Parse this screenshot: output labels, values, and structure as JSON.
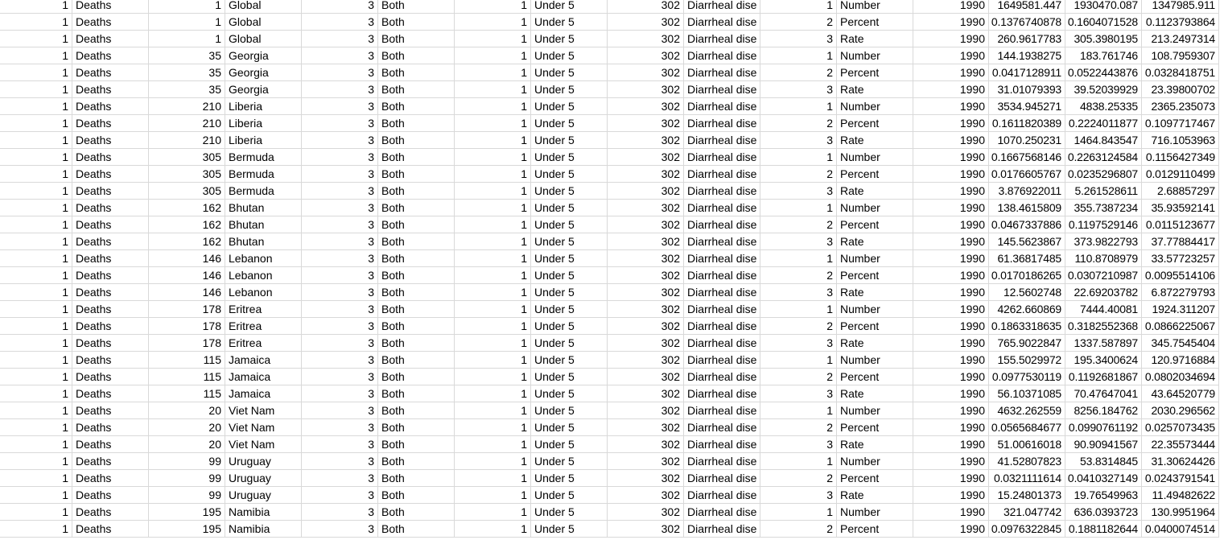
{
  "sheet": {
    "rows": [
      [
        "1",
        "Deaths",
        "1",
        "Global",
        "3",
        "Both",
        "1",
        "Under 5",
        "302",
        "Diarrheal dise",
        "1",
        "Number",
        "1990",
        "1649581.447",
        "1930470.087",
        "1347985.911"
      ],
      [
        "1",
        "Deaths",
        "1",
        "Global",
        "3",
        "Both",
        "1",
        "Under 5",
        "302",
        "Diarrheal dise",
        "2",
        "Percent",
        "1990",
        "0.1376740878",
        "0.1604071528",
        "0.1123793864"
      ],
      [
        "1",
        "Deaths",
        "1",
        "Global",
        "3",
        "Both",
        "1",
        "Under 5",
        "302",
        "Diarrheal dise",
        "3",
        "Rate",
        "1990",
        "260.9617783",
        "305.3980195",
        "213.2497314"
      ],
      [
        "1",
        "Deaths",
        "35",
        "Georgia",
        "3",
        "Both",
        "1",
        "Under 5",
        "302",
        "Diarrheal dise",
        "1",
        "Number",
        "1990",
        "144.1938275",
        "183.761746",
        "108.7959307"
      ],
      [
        "1",
        "Deaths",
        "35",
        "Georgia",
        "3",
        "Both",
        "1",
        "Under 5",
        "302",
        "Diarrheal dise",
        "2",
        "Percent",
        "1990",
        "0.0417128911",
        "0.0522443876",
        "0.0328418751"
      ],
      [
        "1",
        "Deaths",
        "35",
        "Georgia",
        "3",
        "Both",
        "1",
        "Under 5",
        "302",
        "Diarrheal dise",
        "3",
        "Rate",
        "1990",
        "31.01079393",
        "39.52039929",
        "23.39800702"
      ],
      [
        "1",
        "Deaths",
        "210",
        "Liberia",
        "3",
        "Both",
        "1",
        "Under 5",
        "302",
        "Diarrheal dise",
        "1",
        "Number",
        "1990",
        "3534.945271",
        "4838.25335",
        "2365.235073"
      ],
      [
        "1",
        "Deaths",
        "210",
        "Liberia",
        "3",
        "Both",
        "1",
        "Under 5",
        "302",
        "Diarrheal dise",
        "2",
        "Percent",
        "1990",
        "0.1611820389",
        "0.2224011877",
        "0.1097717467"
      ],
      [
        "1",
        "Deaths",
        "210",
        "Liberia",
        "3",
        "Both",
        "1",
        "Under 5",
        "302",
        "Diarrheal dise",
        "3",
        "Rate",
        "1990",
        "1070.250231",
        "1464.843547",
        "716.1053963"
      ],
      [
        "1",
        "Deaths",
        "305",
        "Bermuda",
        "3",
        "Both",
        "1",
        "Under 5",
        "302",
        "Diarrheal dise",
        "1",
        "Number",
        "1990",
        "0.1667568146",
        "0.2263124584",
        "0.1156427349"
      ],
      [
        "1",
        "Deaths",
        "305",
        "Bermuda",
        "3",
        "Both",
        "1",
        "Under 5",
        "302",
        "Diarrheal dise",
        "2",
        "Percent",
        "1990",
        "0.0176605767",
        "0.0235296807",
        "0.0129110499"
      ],
      [
        "1",
        "Deaths",
        "305",
        "Bermuda",
        "3",
        "Both",
        "1",
        "Under 5",
        "302",
        "Diarrheal dise",
        "3",
        "Rate",
        "1990",
        "3.876922011",
        "5.261528611",
        "2.68857297"
      ],
      [
        "1",
        "Deaths",
        "162",
        "Bhutan",
        "3",
        "Both",
        "1",
        "Under 5",
        "302",
        "Diarrheal dise",
        "1",
        "Number",
        "1990",
        "138.4615809",
        "355.7387234",
        "35.93592141"
      ],
      [
        "1",
        "Deaths",
        "162",
        "Bhutan",
        "3",
        "Both",
        "1",
        "Under 5",
        "302",
        "Diarrheal dise",
        "2",
        "Percent",
        "1990",
        "0.0467337886",
        "0.1197529146",
        "0.0115123677"
      ],
      [
        "1",
        "Deaths",
        "162",
        "Bhutan",
        "3",
        "Both",
        "1",
        "Under 5",
        "302",
        "Diarrheal dise",
        "3",
        "Rate",
        "1990",
        "145.5623867",
        "373.9822793",
        "37.77884417"
      ],
      [
        "1",
        "Deaths",
        "146",
        "Lebanon",
        "3",
        "Both",
        "1",
        "Under 5",
        "302",
        "Diarrheal dise",
        "1",
        "Number",
        "1990",
        "61.36817485",
        "110.8708979",
        "33.57723257"
      ],
      [
        "1",
        "Deaths",
        "146",
        "Lebanon",
        "3",
        "Both",
        "1",
        "Under 5",
        "302",
        "Diarrheal dise",
        "2",
        "Percent",
        "1990",
        "0.0170186265",
        "0.0307210987",
        "0.0095514106"
      ],
      [
        "1",
        "Deaths",
        "146",
        "Lebanon",
        "3",
        "Both",
        "1",
        "Under 5",
        "302",
        "Diarrheal dise",
        "3",
        "Rate",
        "1990",
        "12.5602748",
        "22.69203782",
        "6.872279793"
      ],
      [
        "1",
        "Deaths",
        "178",
        "Eritrea",
        "3",
        "Both",
        "1",
        "Under 5",
        "302",
        "Diarrheal dise",
        "1",
        "Number",
        "1990",
        "4262.660869",
        "7444.40081",
        "1924.311207"
      ],
      [
        "1",
        "Deaths",
        "178",
        "Eritrea",
        "3",
        "Both",
        "1",
        "Under 5",
        "302",
        "Diarrheal dise",
        "2",
        "Percent",
        "1990",
        "0.1863318635",
        "0.3182552368",
        "0.0866225067"
      ],
      [
        "1",
        "Deaths",
        "178",
        "Eritrea",
        "3",
        "Both",
        "1",
        "Under 5",
        "302",
        "Diarrheal dise",
        "3",
        "Rate",
        "1990",
        "765.9022847",
        "1337.587897",
        "345.7545404"
      ],
      [
        "1",
        "Deaths",
        "115",
        "Jamaica",
        "3",
        "Both",
        "1",
        "Under 5",
        "302",
        "Diarrheal dise",
        "1",
        "Number",
        "1990",
        "155.5029972",
        "195.3400624",
        "120.9716884"
      ],
      [
        "1",
        "Deaths",
        "115",
        "Jamaica",
        "3",
        "Both",
        "1",
        "Under 5",
        "302",
        "Diarrheal dise",
        "2",
        "Percent",
        "1990",
        "0.0977530119",
        "0.1192681867",
        "0.0802034694"
      ],
      [
        "1",
        "Deaths",
        "115",
        "Jamaica",
        "3",
        "Both",
        "1",
        "Under 5",
        "302",
        "Diarrheal dise",
        "3",
        "Rate",
        "1990",
        "56.10371085",
        "70.47647041",
        "43.64520779"
      ],
      [
        "1",
        "Deaths",
        "20",
        "Viet Nam",
        "3",
        "Both",
        "1",
        "Under 5",
        "302",
        "Diarrheal dise",
        "1",
        "Number",
        "1990",
        "4632.262559",
        "8256.184762",
        "2030.296562"
      ],
      [
        "1",
        "Deaths",
        "20",
        "Viet Nam",
        "3",
        "Both",
        "1",
        "Under 5",
        "302",
        "Diarrheal dise",
        "2",
        "Percent",
        "1990",
        "0.0565684677",
        "0.0990761192",
        "0.0257073435"
      ],
      [
        "1",
        "Deaths",
        "20",
        "Viet Nam",
        "3",
        "Both",
        "1",
        "Under 5",
        "302",
        "Diarrheal dise",
        "3",
        "Rate",
        "1990",
        "51.00616018",
        "90.90941567",
        "22.35573444"
      ],
      [
        "1",
        "Deaths",
        "99",
        "Uruguay",
        "3",
        "Both",
        "1",
        "Under 5",
        "302",
        "Diarrheal dise",
        "1",
        "Number",
        "1990",
        "41.52807823",
        "53.8314845",
        "31.30624426"
      ],
      [
        "1",
        "Deaths",
        "99",
        "Uruguay",
        "3",
        "Both",
        "1",
        "Under 5",
        "302",
        "Diarrheal dise",
        "2",
        "Percent",
        "1990",
        "0.0321111614",
        "0.0410327149",
        "0.0243791541"
      ],
      [
        "1",
        "Deaths",
        "99",
        "Uruguay",
        "3",
        "Both",
        "1",
        "Under 5",
        "302",
        "Diarrheal dise",
        "3",
        "Rate",
        "1990",
        "15.24801373",
        "19.76549963",
        "11.49482622"
      ],
      [
        "1",
        "Deaths",
        "195",
        "Namibia",
        "3",
        "Both",
        "1",
        "Under 5",
        "302",
        "Diarrheal dise",
        "1",
        "Number",
        "1990",
        "321.047742",
        "636.0393723",
        "130.9951964"
      ],
      [
        "1",
        "Deaths",
        "195",
        "Namibia",
        "3",
        "Both",
        "1",
        "Under 5",
        "302",
        "Diarrheal dise",
        "2",
        "Percent",
        "1990",
        "0.0976322845",
        "0.1881182644",
        "0.0400074514"
      ]
    ]
  }
}
